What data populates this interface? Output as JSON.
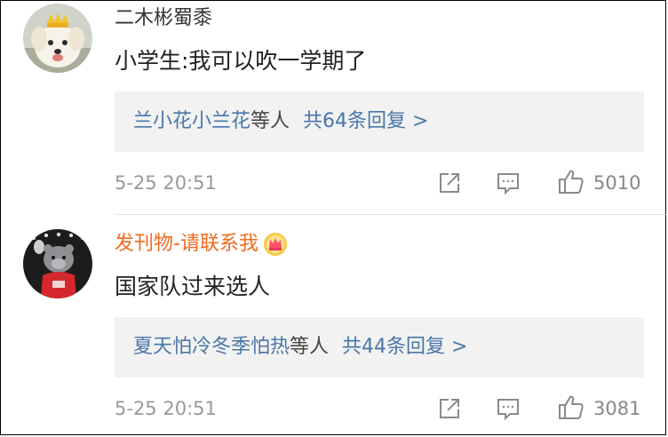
{
  "comments": [
    {
      "username": "二木彬蜀黍",
      "username_color": "#333333",
      "avatar": "white-dog-with-crown-avatar",
      "content": "小学生:我可以吹一学期了",
      "replies": {
        "names": "兰小花小兰花",
        "suffix": "等人",
        "count_text": "共64条回复 >"
      },
      "timestamp": "5-25 20:51",
      "likes": "5010"
    },
    {
      "username": "发刊物-请联系我",
      "username_color": "#f06a1e",
      "badge": "crown-vip-icon",
      "avatar": "bear-mascot-basketball-avatar",
      "content": "国家队过来选人",
      "replies": {
        "names": "夏天怕冷冬季怕热",
        "suffix": "等人",
        "count_text": "共44条回复 >"
      },
      "timestamp": "5-25 20:51",
      "likes": "3081"
    }
  ],
  "colors": {
    "reply_link": "#4a76a8",
    "meta_gray": "#999999",
    "reply_bg": "#f2f2f2"
  }
}
